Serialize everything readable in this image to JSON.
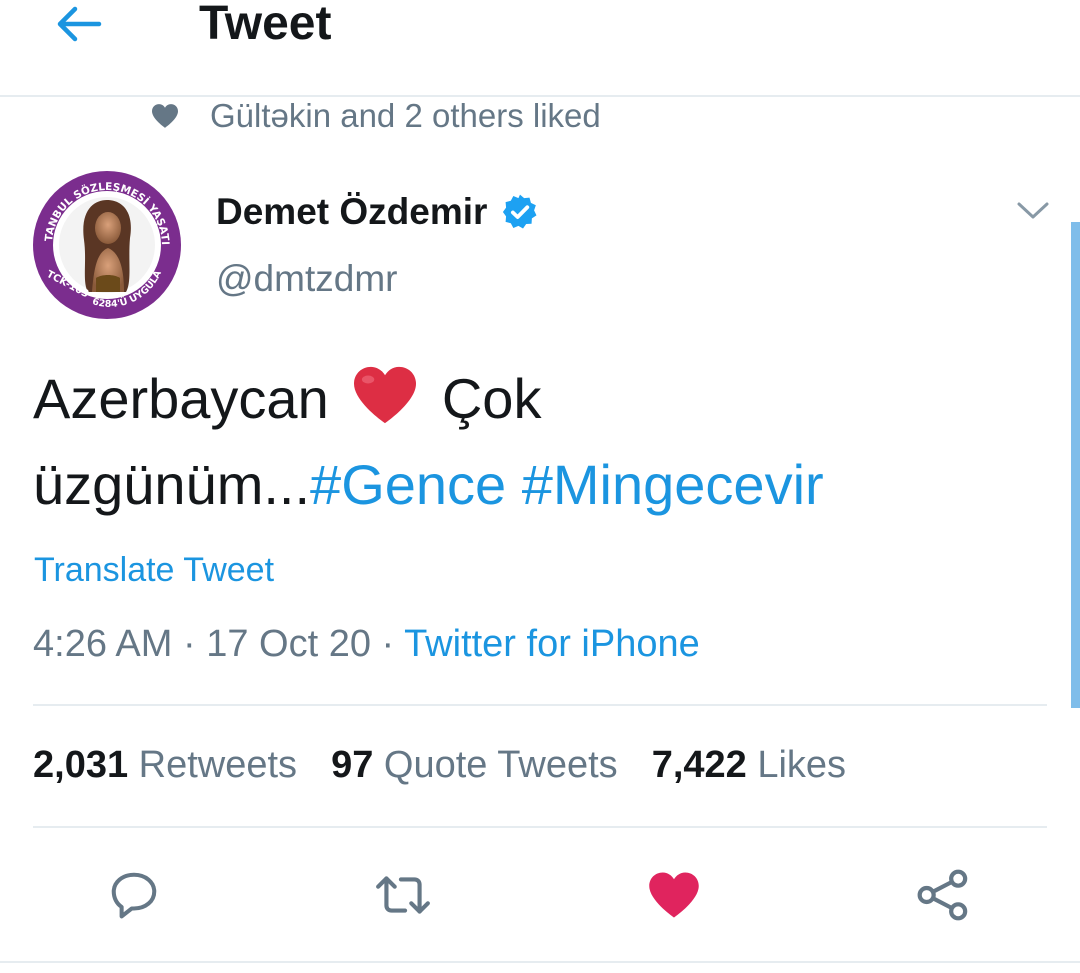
{
  "header": {
    "title": "Tweet",
    "back_icon": "arrow-left-icon"
  },
  "social_context": {
    "text": "Gültəkin and 2 others liked",
    "icon": "heart-icon"
  },
  "author": {
    "name": "Demet Özdemir",
    "handle": "@dmtzdmr",
    "verified": true,
    "avatar_ring_top": "İSTANBUL SÖZLEŞMESİ YAŞATIR",
    "avatar_ring_left": "TCK-103",
    "avatar_ring_bottom": "6284'Ü UYGULA"
  },
  "tweet": {
    "text_part1": "Azerbaycan",
    "text_part2": "Çok",
    "text_part3": "üzgünüm...",
    "hashtag1": "#Gence",
    "hashtag2": "#Mingecevir",
    "translate_label": "Translate Tweet",
    "time": "4:26 AM",
    "date": "17 Oct 20",
    "separator": "·",
    "source": "Twitter for iPhone"
  },
  "stats": {
    "retweets_count": "2,031",
    "retweets_label": "Retweets",
    "quotes_count": "97",
    "quotes_label": "Quote Tweets",
    "likes_count": "7,422",
    "likes_label": "Likes"
  },
  "actions": {
    "reply_icon": "reply-icon",
    "retweet_icon": "retweet-icon",
    "like_icon": "heart-filled-icon",
    "share_icon": "share-icon"
  },
  "colors": {
    "link": "#1b95e0",
    "secondary_text": "#657786",
    "like": "#e0245e",
    "avatar_ring": "#7b2d8e",
    "verified": "#1da1f2"
  }
}
